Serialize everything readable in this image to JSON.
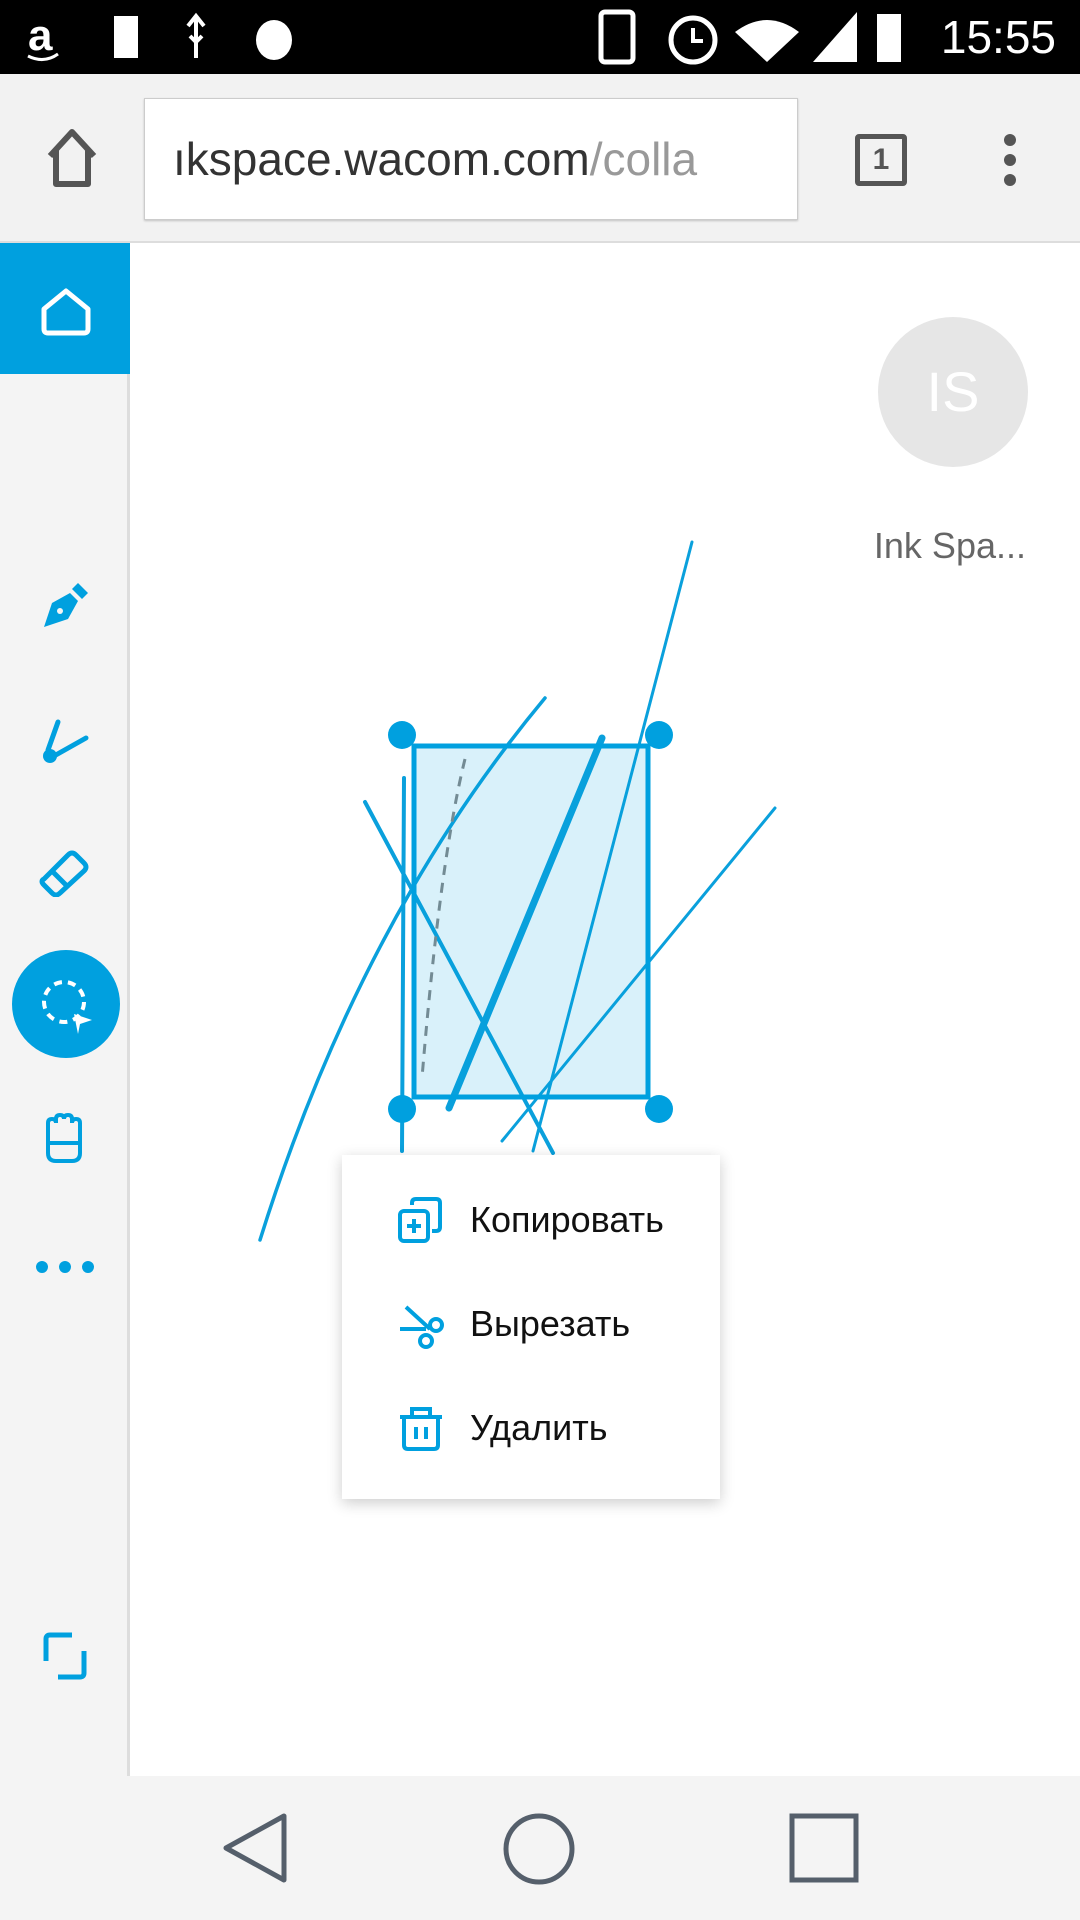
{
  "status_bar": {
    "time": "15:55",
    "icons": [
      "amazon-icon",
      "battery-usb-icon",
      "usb-icon",
      "bug-icon",
      "vibrate-icon",
      "alarm-icon",
      "wifi-icon",
      "signal-icon",
      "battery-charging-icon"
    ]
  },
  "browser": {
    "url_main": "ıkspace.wacom.com",
    "url_rest": "/colla",
    "tab_count": "1"
  },
  "sidebar": {
    "tools": [
      "home",
      "pen",
      "brush",
      "eraser",
      "select",
      "hand",
      "more",
      "fullscreen"
    ],
    "active_tool": "select",
    "accent": "#00a0df"
  },
  "user": {
    "initials": "IS",
    "name": "Ink Spa..."
  },
  "context_menu": {
    "items": [
      {
        "label": "Копировать",
        "icon": "copy-icon"
      },
      {
        "label": "Вырезать",
        "icon": "cut-icon"
      },
      {
        "label": "Удалить",
        "icon": "trash-icon"
      }
    ]
  }
}
